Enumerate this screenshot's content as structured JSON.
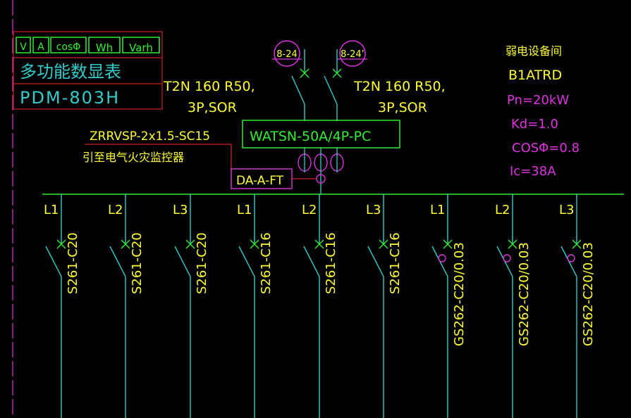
{
  "colors": {
    "background": "#000000",
    "yellow": "#ffff33",
    "cyan": "#33cccc",
    "green": "#33ee33",
    "magenta": "#dd33dd",
    "red": "#cc2222"
  },
  "meter": {
    "buttons": [
      "V",
      "A",
      "cosΦ",
      "Wh",
      "Varh"
    ],
    "name": "多功能数显表",
    "model": "PDM-803H"
  },
  "tags": {
    "left": "8-24",
    "right": "8-24’"
  },
  "breakers": {
    "left_line1": "T2N 160 R50,",
    "left_line2": "3P,SOR",
    "right_line1": "T2N 160 R50,",
    "right_line2": "3P,SOR"
  },
  "cable": {
    "spec": "ZRRVSP-2x1.5-SC15",
    "label": "引至电气火灾监控器"
  },
  "ats": "WATSN-50A/4P-PC",
  "fire_monitor": "DA-A-FT",
  "panel": {
    "room": "弱电设备间",
    "name": "B1ATRD",
    "pn": "Pn=20kW",
    "kd": "Kd=1.0",
    "cos": "COSΦ=0.8",
    "ic": "Ic=38A"
  },
  "circuits": [
    {
      "phase": "L1",
      "device": "S261-C20",
      "rcd": false
    },
    {
      "phase": "L2",
      "device": "S261-C20",
      "rcd": false
    },
    {
      "phase": "L3",
      "device": "S261-C20",
      "rcd": false
    },
    {
      "phase": "L1",
      "device": "S261-C16",
      "rcd": false
    },
    {
      "phase": "L2",
      "device": "S261-C16",
      "rcd": false
    },
    {
      "phase": "L3",
      "device": "S261-C16",
      "rcd": false
    },
    {
      "phase": "L1",
      "device": "GS262-C20/0.03",
      "rcd": true
    },
    {
      "phase": "L2",
      "device": "GS262-C20/0.03",
      "rcd": true
    },
    {
      "phase": "L3",
      "device": "GS262-C20/0.03",
      "rcd": true
    }
  ]
}
